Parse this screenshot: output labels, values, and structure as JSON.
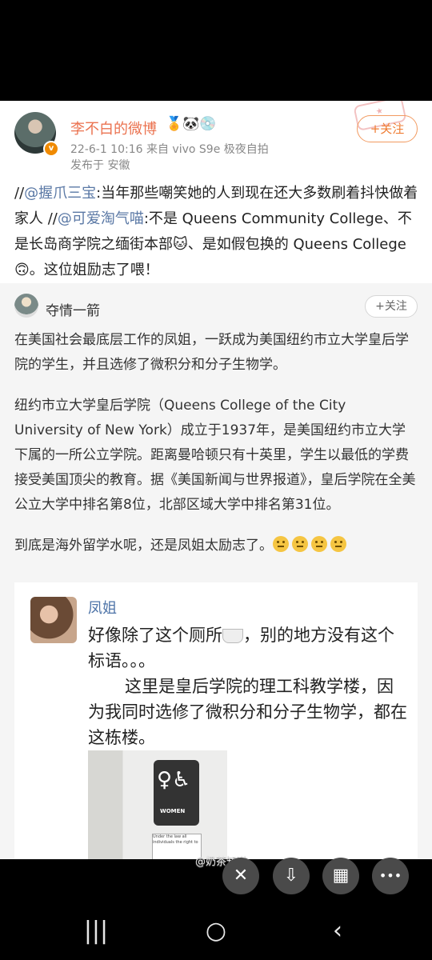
{
  "post": {
    "author": "李不白的微博",
    "author_badges": "🏅🐼💿",
    "meta": "22-6-1 10:16  来自 vivo S9e 极夜自拍",
    "published_from": "发布于 安徽",
    "follow": "+关注",
    "text_parts": [
      "//",
      "@握爪三宝",
      ":当年那些嘲笑她的人到现在还大多数刷着抖快做着家人 //",
      "@可爱淘气喵",
      ":不是 Queens Community College、不是长岛商学院之缅街本部🐱、是如假包换的 Queens College🙃。这位姐励志了喂！"
    ]
  },
  "repost": {
    "author": "夺情一箭",
    "follow": "+关注",
    "paragraphs": [
      "在美国社会最底层工作的凤姐，一跃成为美国纽约市立大学皇后学院的学生，并且选修了微积分和分子生物学。",
      "纽约市立大学皇后学院（Queens College of the City University of New York）成立于1937年，是美国纽约市立大学下属的一所公立学院。距离曼哈顿只有十英里，学生以最低的学费接受美国顶尖的教育。据《美国新闻与世界报道》，皇后学院在全美公立大学中排名第8位，北部区域大学中排名第31位。",
      "到底是海外留学水呢，还是凤姐太励志了。"
    ]
  },
  "embedded": {
    "author": "凤姐",
    "line1_a": "好像除了这个厕所",
    "line1_b": "，别的地方没有这个标语。。。",
    "line2": "这里是皇后学院的理工科教学楼，因为我同时选修了微积分和分子生物学，都在这栋楼。",
    "sign_label": "WOMEN",
    "notice_text": "Under the law all individuals the right to"
  },
  "watermark": "@奶茶知道",
  "icons": {
    "flash": "✕",
    "download": "⇩",
    "grid": "▦",
    "more": "•••"
  }
}
